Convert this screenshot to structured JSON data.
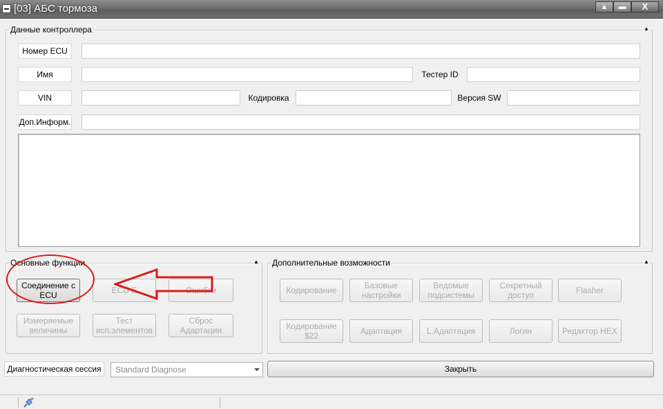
{
  "window": {
    "title": "[03] АБС тормоза",
    "minimize_glyph": "▲",
    "restore_glyph": "▬",
    "close_glyph": "X",
    "system_icon": "window-menu-icon"
  },
  "controller": {
    "legend": "Данные контроллера",
    "ecu_number_label": "Номер ECU",
    "ecu_number_value": "",
    "name_label": "Имя",
    "name_value": "",
    "tester_id_label": "Тестер ID",
    "tester_id_value": "",
    "vin_label": "VIN",
    "vin_value": "",
    "coding_label": "Кодировка",
    "coding_value": "",
    "sw_version_label": "Версия SW",
    "sw_version_value": "",
    "extra_info_label": "Доп.Информ.",
    "extra_info_value": "",
    "memo_text": ""
  },
  "basic": {
    "legend": "Основные функции",
    "buttons": [
      {
        "label": "Соединение с ECU",
        "enabled": true
      },
      {
        "label": "ECU E",
        "enabled": false
      },
      {
        "label": "Ошибки",
        "enabled": false
      },
      {
        "label": "Измеряемые величины",
        "enabled": false
      },
      {
        "label": "Тест исп.элементов",
        "enabled": false
      },
      {
        "label": "Сброс Адартации",
        "enabled": false
      }
    ]
  },
  "extra": {
    "legend": "Дополнительные возможности",
    "buttons": [
      {
        "label": "Кодирование",
        "enabled": false
      },
      {
        "label": "Базовые настройки",
        "enabled": false
      },
      {
        "label": "Ведомые подсистемы",
        "enabled": false
      },
      {
        "label": "Секретный доступ",
        "enabled": false
      },
      {
        "label": "Flasher",
        "enabled": false
      },
      {
        "label": "Кодирование $22",
        "enabled": false
      },
      {
        "label": "Адаптация",
        "enabled": false
      },
      {
        "label": "L.Адаптация",
        "enabled": false
      },
      {
        "label": "Логин",
        "enabled": false
      },
      {
        "label": "Редактор HEX",
        "enabled": false
      }
    ]
  },
  "session": {
    "label": "Диагностическая сессия",
    "selected": "Standard Diagnose"
  },
  "close_button": "Закрыть",
  "colors": {
    "highlight": "#e01818",
    "disabled_text": "#aaaaaa"
  }
}
